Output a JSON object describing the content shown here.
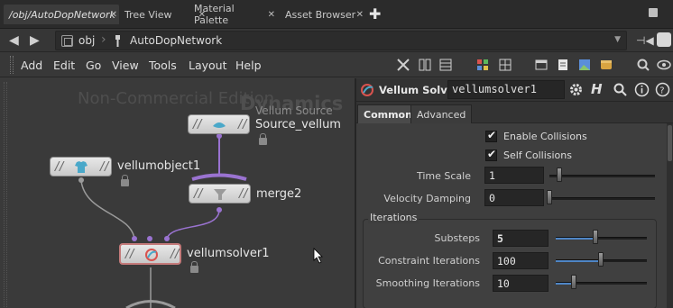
{
  "tabs": [
    {
      "label": "/obj/AutoDopNetwork",
      "active": true
    },
    {
      "label": "Tree View"
    },
    {
      "label": "Material Palette"
    },
    {
      "label": "Asset Browser"
    }
  ],
  "pathbar": {
    "crumbs": [
      "obj",
      "AutoDopNetwork"
    ]
  },
  "menus": [
    "Add",
    "Edit",
    "Go",
    "View",
    "Tools",
    "Layout",
    "Help"
  ],
  "network": {
    "watermark": "Non-Commercial Edition",
    "context_label": "Dynamics",
    "nodes": {
      "source": {
        "type_label": "Vellum Source",
        "name": "Source_vellum"
      },
      "vellumobject": {
        "name": "vellumobject1"
      },
      "merge": {
        "name": "merge2"
      },
      "solver": {
        "name": "vellumsolver1"
      }
    }
  },
  "params": {
    "title": "Vellum Solver",
    "node_name": "vellumsolver1",
    "tabs": [
      "Common",
      "Advanced"
    ],
    "enable_collisions": {
      "label": "Enable Collisions",
      "checked": true
    },
    "self_collisions": {
      "label": "Self Collisions",
      "checked": true
    },
    "time_scale": {
      "label": "Time Scale",
      "value": "1"
    },
    "velocity_damping": {
      "label": "Velocity Damping",
      "value": "0"
    },
    "iterations_group": "Iterations",
    "substeps": {
      "label": "Substeps",
      "value": "5"
    },
    "constraint_iterations": {
      "label": "Constraint Iterations",
      "value": "100"
    },
    "smoothing_iterations": {
      "label": "Smoothing Iterations",
      "value": "10"
    }
  },
  "colors": {
    "accent": "#4f86c6",
    "wire": "#9a73d1",
    "selected_node_outline": "#c47a7a"
  }
}
